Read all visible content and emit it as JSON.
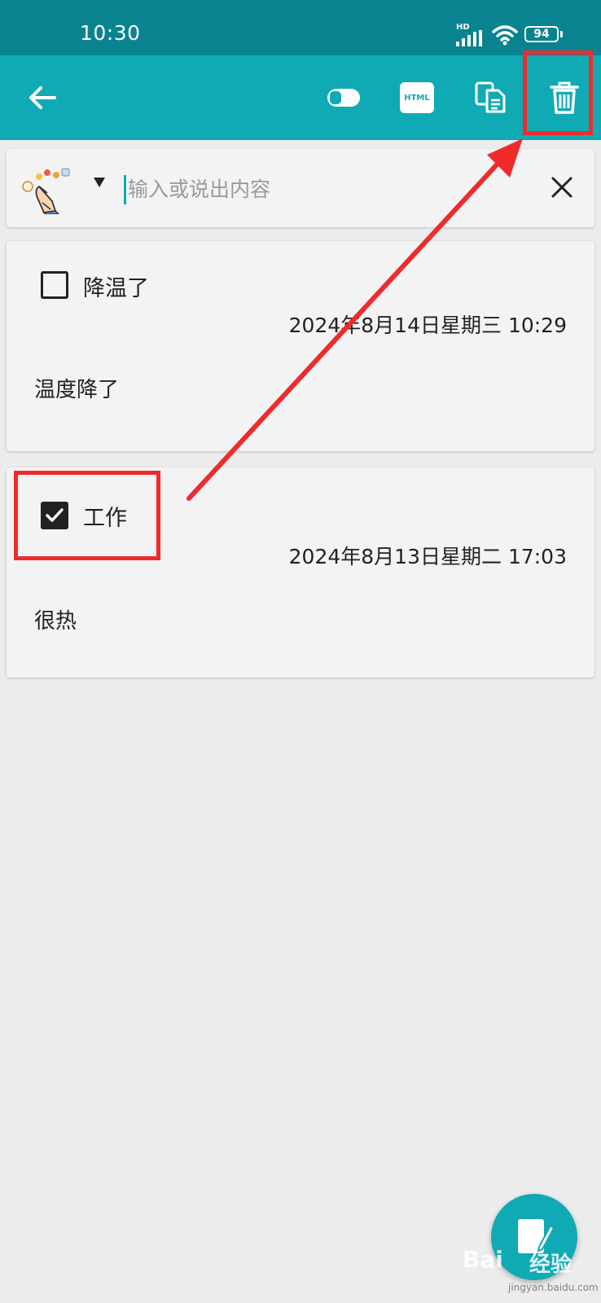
{
  "status_bar": {
    "time": "10:30",
    "network_badge": "HD",
    "battery_level": "94",
    "background_color": "#0a8390"
  },
  "app_bar": {
    "background_color": "#10aab5",
    "icons": [
      "back-arrow-icon",
      "toggle-icon",
      "html-icon",
      "copy-icon",
      "trash-icon"
    ],
    "html_label": "HTML"
  },
  "search": {
    "placeholder": "输入或说出内容",
    "value": "",
    "dropdown_indicator": "▼"
  },
  "notes": [
    {
      "title": "降温了",
      "checked": false,
      "datetime": "2024年8月14日星期三 10:29",
      "body": "温度降了"
    },
    {
      "title": "工作",
      "checked": true,
      "datetime": "2024年8月13日星期二 17:03",
      "body": "很热"
    }
  ],
  "annotation_color": "#ef2b2b",
  "watermark": {
    "brand": "Bai",
    "brand_suffix": "经验",
    "url": "jingyan.baidu.com"
  }
}
